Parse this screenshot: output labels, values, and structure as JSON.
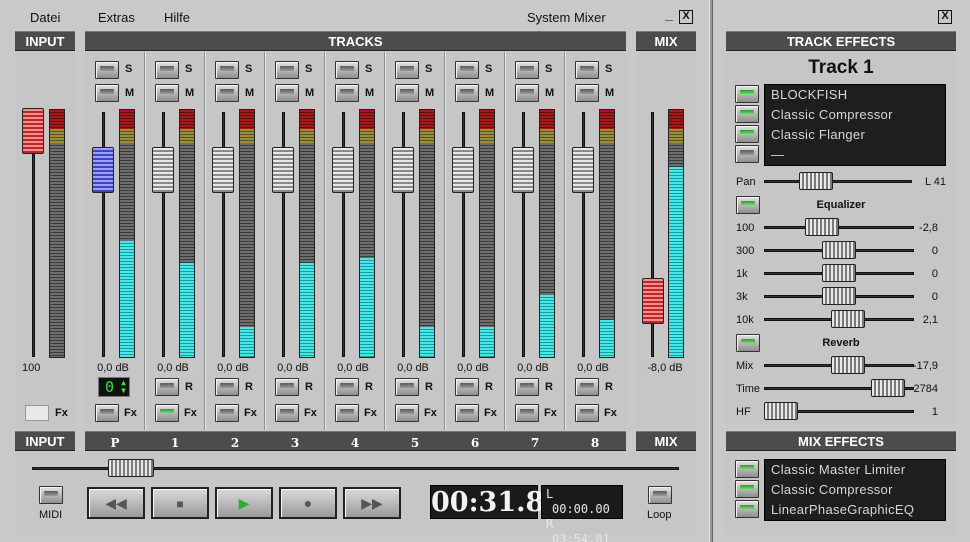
{
  "menu": {
    "file": "Datei",
    "extras": "Extras",
    "help": "Hilfe",
    "title": "System Mixer"
  },
  "window": {
    "minimize": "_",
    "close": "X"
  },
  "headers": {
    "input": "INPUT",
    "tracks": "TRACKS",
    "mix": "MIX",
    "track_effects": "TRACK EFFECTS",
    "mix_effects": "MIX EFFECTS"
  },
  "input": {
    "level": "100",
    "fx": "Fx",
    "footer": "INPUT",
    "fader_level": 0.82,
    "meter_level": 0.0
  },
  "tracks": [
    {
      "label": "P",
      "db": "0,0 dB",
      "solo": "S",
      "mute": "M",
      "rec": null,
      "fx": "Fx",
      "meter": 0.47,
      "fx_on": false
    },
    {
      "label": "1",
      "db": "0,0 dB",
      "solo": "S",
      "mute": "M",
      "rec": "R",
      "fx": "Fx",
      "meter": 0.38,
      "fx_on": true
    },
    {
      "label": "2",
      "db": "0,0 dB",
      "solo": "S",
      "mute": "M",
      "rec": "R",
      "fx": "Fx",
      "meter": 0.12,
      "fx_on": false
    },
    {
      "label": "3",
      "db": "0,0 dB",
      "solo": "S",
      "mute": "M",
      "rec": "R",
      "fx": "Fx",
      "meter": 0.38,
      "fx_on": false
    },
    {
      "label": "4",
      "db": "0,0 dB",
      "solo": "S",
      "mute": "M",
      "rec": "R",
      "fx": "Fx",
      "meter": 0.4,
      "fx_on": false
    },
    {
      "label": "5",
      "db": "0,0 dB",
      "solo": "S",
      "mute": "M",
      "rec": "R",
      "fx": "Fx",
      "meter": 0.12,
      "fx_on": false
    },
    {
      "label": "6",
      "db": "0,0 dB",
      "solo": "S",
      "mute": "M",
      "rec": "R",
      "fx": "Fx",
      "meter": 0.12,
      "fx_on": false
    },
    {
      "label": "7",
      "db": "0,0 dB",
      "solo": "S",
      "mute": "M",
      "rec": "R",
      "fx": "Fx",
      "meter": 0.25,
      "fx_on": false
    },
    {
      "label": "8",
      "db": "0,0 dB",
      "solo": "S",
      "mute": "M",
      "rec": "R",
      "fx": "Fx",
      "meter": 0.15,
      "fx_on": false
    }
  ],
  "metronome_value": "0",
  "mix": {
    "db": "-8,0 dB",
    "footer": "MIX",
    "meter_left": 0.77,
    "meter_right": 0.75
  },
  "track_effects": {
    "track_name": "Track 1",
    "effects": [
      "BLOCKFISH",
      "Classic Compressor",
      "Classic Flanger",
      "—"
    ],
    "pan_label": "Pan",
    "pan_value": "L 41",
    "equalizer_label": "Equalizer",
    "eq": [
      {
        "band": "100",
        "value": "-2,8",
        "pos": 0.35
      },
      {
        "band": "300",
        "value": "0",
        "pos": 0.5
      },
      {
        "band": "1k",
        "value": "0",
        "pos": 0.5
      },
      {
        "band": "3k",
        "value": "0",
        "pos": 0.5
      },
      {
        "band": "10k",
        "value": "2,1",
        "pos": 0.58
      }
    ],
    "reverb_label": "Reverb",
    "reverb": [
      {
        "param": "Mix",
        "value": "-17,9",
        "pos": 0.58
      },
      {
        "param": "Time",
        "value": "2784",
        "pos": 0.92
      },
      {
        "param": "HF",
        "value": "1",
        "pos": 0.0
      }
    ]
  },
  "mix_effects": [
    "Classic Master Limiter",
    "Classic Compressor",
    "LinearPhaseGraphicEQ"
  ],
  "transport": {
    "midi": "MIDI",
    "loop": "Loop",
    "time": "00:31.8",
    "l_label": "L",
    "l_time": "00:00.00",
    "r_label": "R",
    "r_time": "03:54.81",
    "position": 0.15
  },
  "colors": {
    "header_bg": "#4c4c4c",
    "meter_cyan": "#48e6e6",
    "led_green": "#2e9a2e"
  }
}
